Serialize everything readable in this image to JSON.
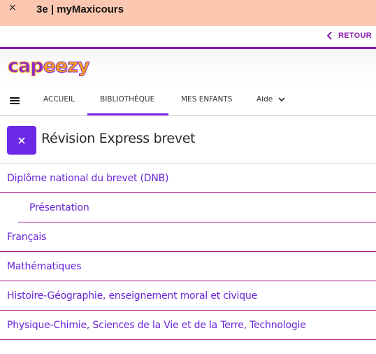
{
  "topbar": {
    "close_glyph": "×",
    "title": "3e | myMaxicours"
  },
  "back": {
    "label": "RETOUR",
    "icon": "chevron-left-icon"
  },
  "logo": {
    "part1": "cap",
    "part2": "eezy"
  },
  "nav": {
    "menu_icon": "hamburger-menu-icon",
    "items": [
      {
        "label": "ACCUEIL"
      },
      {
        "label": "BIBLIOTHÈQUE",
        "active": true
      },
      {
        "label": "MES ENFANTS"
      },
      {
        "label": "Aide",
        "icon": "chevron-down-icon"
      }
    ]
  },
  "section": {
    "close_icon": "close-icon",
    "title": "Révision Express brevet"
  },
  "list": [
    {
      "label": "Diplôme national du brevet (DNB)"
    },
    {
      "label": "Présentation",
      "indent": true
    },
    {
      "label": "Français"
    },
    {
      "label": "Mathématiques"
    },
    {
      "label": "Histoire-Géographie, enseignement moral et civique"
    },
    {
      "label": "Physique-Chimie, Sciences de la Vie et de la Terre, Technologie"
    }
  ],
  "colors": {
    "topbar": "#fcc7b0",
    "accent": "#6d28e6",
    "brand": "#8c1aae",
    "link": "#6a25d6"
  }
}
